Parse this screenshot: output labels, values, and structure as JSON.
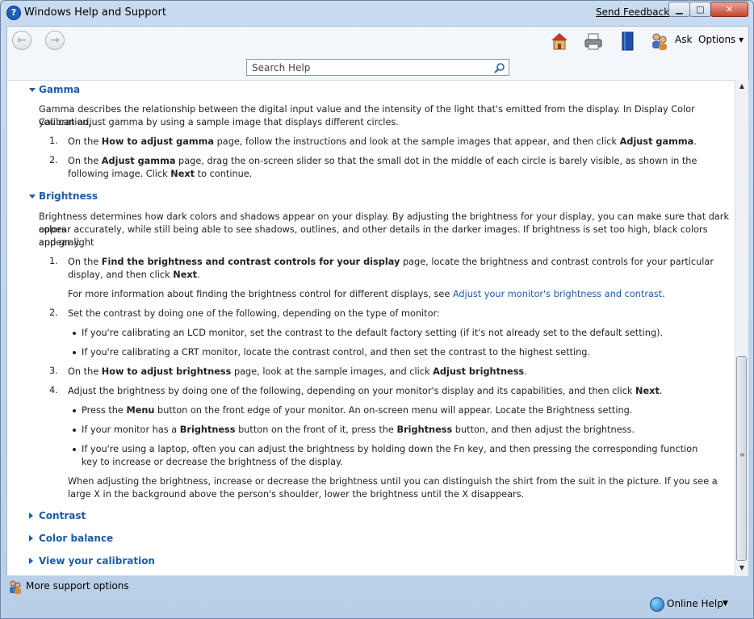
{
  "window": {
    "title": "Windows Help and Support",
    "send_feedback": "Send Feedback"
  },
  "toolbar": {
    "ask_label": "Ask",
    "options_label": "Options ▾",
    "search_placeholder": "Search Help"
  },
  "gamma": {
    "heading": "Gamma",
    "intro_1": "Gamma describes the relationship between the digital input value and the intensity of the light that's emitted from the display. In Display Color Calibration,",
    "intro_2": "you can adjust gamma by using a sample image that displays different circles.",
    "step1_num": "1.",
    "step1_a": "On the ",
    "step1_b": "How to adjust gamma",
    "step1_c": " page, follow the instructions and look at the sample images that appear, and then click ",
    "step1_d": "Adjust gamma",
    "step1_e": ".",
    "step2_num": "2.",
    "step2_a": "On the ",
    "step2_b": "Adjust gamma",
    "step2_c": " page, drag the on-screen slider so that the small dot in the middle of each circle is barely visible, as shown in the",
    "step2_d": "following image. Click ",
    "step2_e": "Next",
    "step2_f": " to continue."
  },
  "brightness": {
    "heading": "Brightness",
    "intro_1": "Brightness determines how dark colors and shadows appear on your display. By adjusting the brightness for your display, you can make sure that dark colors",
    "intro_2": "appear accurately, while still being able to see shadows, outlines, and other details in the darker images. If brightness is set too high, black colors appear light",
    "intro_3": "and gray.",
    "s1_num": "1.",
    "s1_a": "On the ",
    "s1_b": "Find the brightness and contrast controls for your display",
    "s1_c": " page, locate the brightness and contrast controls for your particular",
    "s1_d": "display, and then click ",
    "s1_e": "Next",
    "s1_f": ".",
    "s1_more": "For more information about finding the brightness control for different displays, see ",
    "s1_link": "Adjust your monitor's brightness and contrast",
    "s1_end": ".",
    "s2_num": "2.",
    "s2_text": "Set the contrast by doing one of the following, depending on the type of monitor:",
    "s2_b1": "If you're calibrating an LCD monitor, set the contrast to the default factory setting (if it's not already set to the default setting).",
    "s2_b2": "If you're calibrating a CRT monitor, locate the contrast control, and then set the contrast to the highest setting.",
    "s3_num": "3.",
    "s3_a": "On the ",
    "s3_b": "How to adjust brightness",
    "s3_c": " page, look at the sample images, and click ",
    "s3_d": "Adjust brightness",
    "s3_e": ".",
    "s4_num": "4.",
    "s4_a": "Adjust the brightness by doing one of the following, depending on your monitor's display and its capabilities, and then click ",
    "s4_b": "Next",
    "s4_c": ".",
    "s4_b1_a": "Press the ",
    "s4_b1_b": "Menu",
    "s4_b1_c": " button on the front edge of your monitor. An on-screen menu will appear. Locate the Brightness setting.",
    "s4_b2_a": "If your monitor has a ",
    "s4_b2_b": "Brightness",
    "s4_b2_c": " button on the front of it, press the ",
    "s4_b2_d": "Brightness",
    "s4_b2_e": " button, and then adjust the brightness.",
    "s4_b3_1": "If you're using a laptop, often you can adjust the brightness by holding down the Fn key, and then pressing the corresponding function",
    "s4_b3_2": "key to increase or decrease the brightness of the display.",
    "s4_note_1": "When adjusting the brightness, increase or decrease the brightness until you can distinguish the shirt from the suit in the picture. If you see a",
    "s4_note_2": "large X in the background above the person's shoulder, lower the brightness until the X disappears."
  },
  "collapsed": {
    "contrast": "Contrast",
    "color_balance": "Color balance",
    "view_calibration": "View your calibration"
  },
  "footer": {
    "more_support": "More support options",
    "online_help": "Online Help"
  },
  "icons": {
    "app": "help-question-icon",
    "home": "home-icon",
    "print": "printer-icon",
    "browse": "book-icon",
    "ask": "people-icon",
    "search": "magnifier-icon",
    "globe": "globe-icon"
  }
}
